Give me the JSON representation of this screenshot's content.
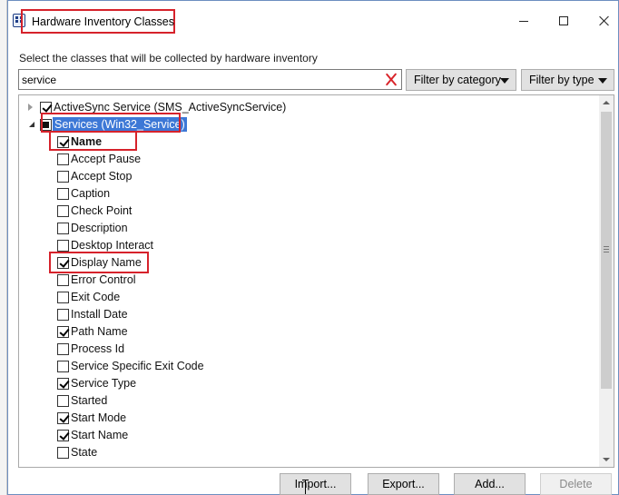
{
  "window": {
    "title": "Hardware Inventory Classes",
    "instruction": "Select the classes that will be collected by hardware inventory"
  },
  "search": {
    "value": "service"
  },
  "filters": {
    "category_label": "Filter by category",
    "type_label": "Filter by type"
  },
  "tree": {
    "classes": [
      {
        "label": "ActiveSync Service (SMS_ActiveSyncService)",
        "state": "checked",
        "expanded": false
      },
      {
        "label": "Services (Win32_Service)",
        "state": "partial",
        "expanded": true,
        "selected": true
      }
    ],
    "properties": [
      {
        "label": "Name",
        "checked": true,
        "bold": true
      },
      {
        "label": "Accept Pause",
        "checked": false
      },
      {
        "label": "Accept Stop",
        "checked": false
      },
      {
        "label": "Caption",
        "checked": false
      },
      {
        "label": "Check Point",
        "checked": false
      },
      {
        "label": "Description",
        "checked": false
      },
      {
        "label": "Desktop Interact",
        "checked": false
      },
      {
        "label": "Display Name",
        "checked": true
      },
      {
        "label": "Error Control",
        "checked": false
      },
      {
        "label": "Exit Code",
        "checked": false
      },
      {
        "label": "Install Date",
        "checked": false
      },
      {
        "label": "Path Name",
        "checked": true
      },
      {
        "label": "Process Id",
        "checked": false
      },
      {
        "label": "Service Specific Exit Code",
        "checked": false
      },
      {
        "label": "Service Type",
        "checked": true
      },
      {
        "label": "Started",
        "checked": false
      },
      {
        "label": "Start Mode",
        "checked": true
      },
      {
        "label": "Start Name",
        "checked": true
      },
      {
        "label": "State",
        "checked": false
      }
    ]
  },
  "buttons": {
    "import": "Import...",
    "export": "Export...",
    "add": "Add...",
    "delete": "Delete"
  },
  "colors": {
    "highlight_box": "#d6222b",
    "selection": "#3d78d6"
  }
}
